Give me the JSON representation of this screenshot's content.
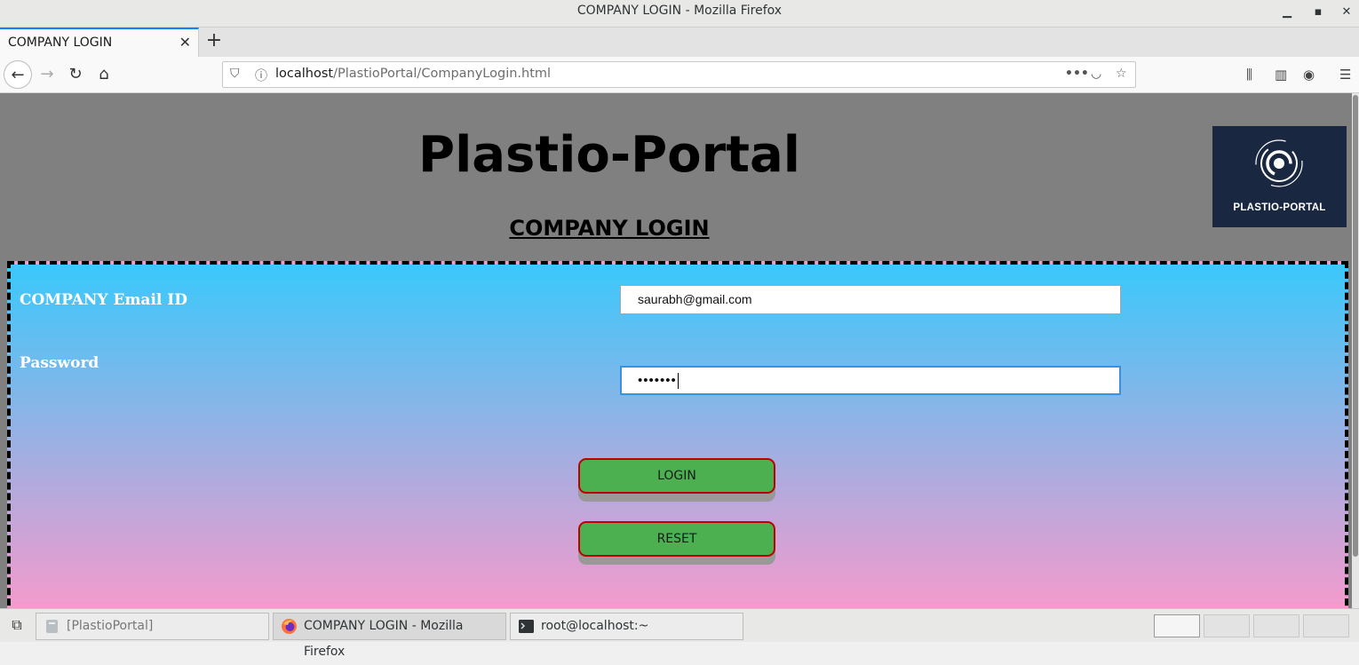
{
  "window": {
    "title": "COMPANY LOGIN - Mozilla Firefox"
  },
  "browser": {
    "tab_label": "COMPANY LOGIN",
    "url_host": "localhost",
    "url_path": "/PlastioPortal/CompanyLogin.html"
  },
  "page": {
    "site_title": "Plastio-Portal",
    "subtitle": "COMPANY LOGIN",
    "logo_text": "PLASTIO-PORTAL",
    "email_label": "COMPANY Email ID",
    "email_value": "saurabh@gmail.com",
    "password_label": "Password",
    "password_masked": "•••••••",
    "login_label": "LOGIN",
    "reset_label": "RESET"
  },
  "taskbar": {
    "items": [
      {
        "label": "[PlastioPortal]",
        "icon": "file-manager-icon"
      },
      {
        "label": "COMPANY LOGIN - Mozilla Firefox",
        "icon": "firefox-icon"
      },
      {
        "label": "root@localhost:~",
        "icon": "terminal-icon"
      }
    ]
  },
  "colors": {
    "page_bg": "#808080",
    "gradient_top": "#3ac8fb",
    "gradient_bottom": "#f69acc",
    "button_green": "#4caf50",
    "button_border": "#c00000",
    "logo_bg": "#1a2740"
  }
}
